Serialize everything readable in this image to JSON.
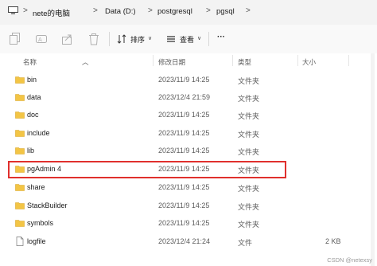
{
  "breadcrumb": {
    "items": [
      "nete的电脑",
      "Data (D:)",
      "postgresql",
      "pgsql"
    ],
    "separator": ">",
    "chevron": "∨"
  },
  "toolbar": {
    "sort_label": "排序",
    "view_label": "查看",
    "more_label": "···"
  },
  "columns": {
    "name": "名称",
    "date": "修改日期",
    "type": "类型",
    "size": "大小"
  },
  "rows": [
    {
      "name": "bin",
      "date": "2023/11/9 14:25",
      "type": "文件夹",
      "size": "",
      "icon": "folder"
    },
    {
      "name": "data",
      "date": "2023/12/4 21:59",
      "type": "文件夹",
      "size": "",
      "icon": "folder"
    },
    {
      "name": "doc",
      "date": "2023/11/9 14:25",
      "type": "文件夹",
      "size": "",
      "icon": "folder"
    },
    {
      "name": "include",
      "date": "2023/11/9 14:25",
      "type": "文件夹",
      "size": "",
      "icon": "folder"
    },
    {
      "name": "lib",
      "date": "2023/11/9 14:25",
      "type": "文件夹",
      "size": "",
      "icon": "folder"
    },
    {
      "name": "pgAdmin 4",
      "date": "2023/11/9 14:25",
      "type": "文件夹",
      "size": "",
      "icon": "folder"
    },
    {
      "name": "share",
      "date": "2023/11/9 14:25",
      "type": "文件夹",
      "size": "",
      "icon": "folder"
    },
    {
      "name": "StackBuilder",
      "date": "2023/11/9 14:25",
      "type": "文件夹",
      "size": "",
      "icon": "folder"
    },
    {
      "name": "symbols",
      "date": "2023/11/9 14:25",
      "type": "文件夹",
      "size": "",
      "icon": "folder"
    },
    {
      "name": "logfile",
      "date": "2023/12/4 21:24",
      "type": "文件",
      "size": "2 KB",
      "icon": "file"
    }
  ],
  "highlight_color": "#e0302d",
  "folder_color": "#f3c545",
  "watermark": "CSDN @netexsy"
}
